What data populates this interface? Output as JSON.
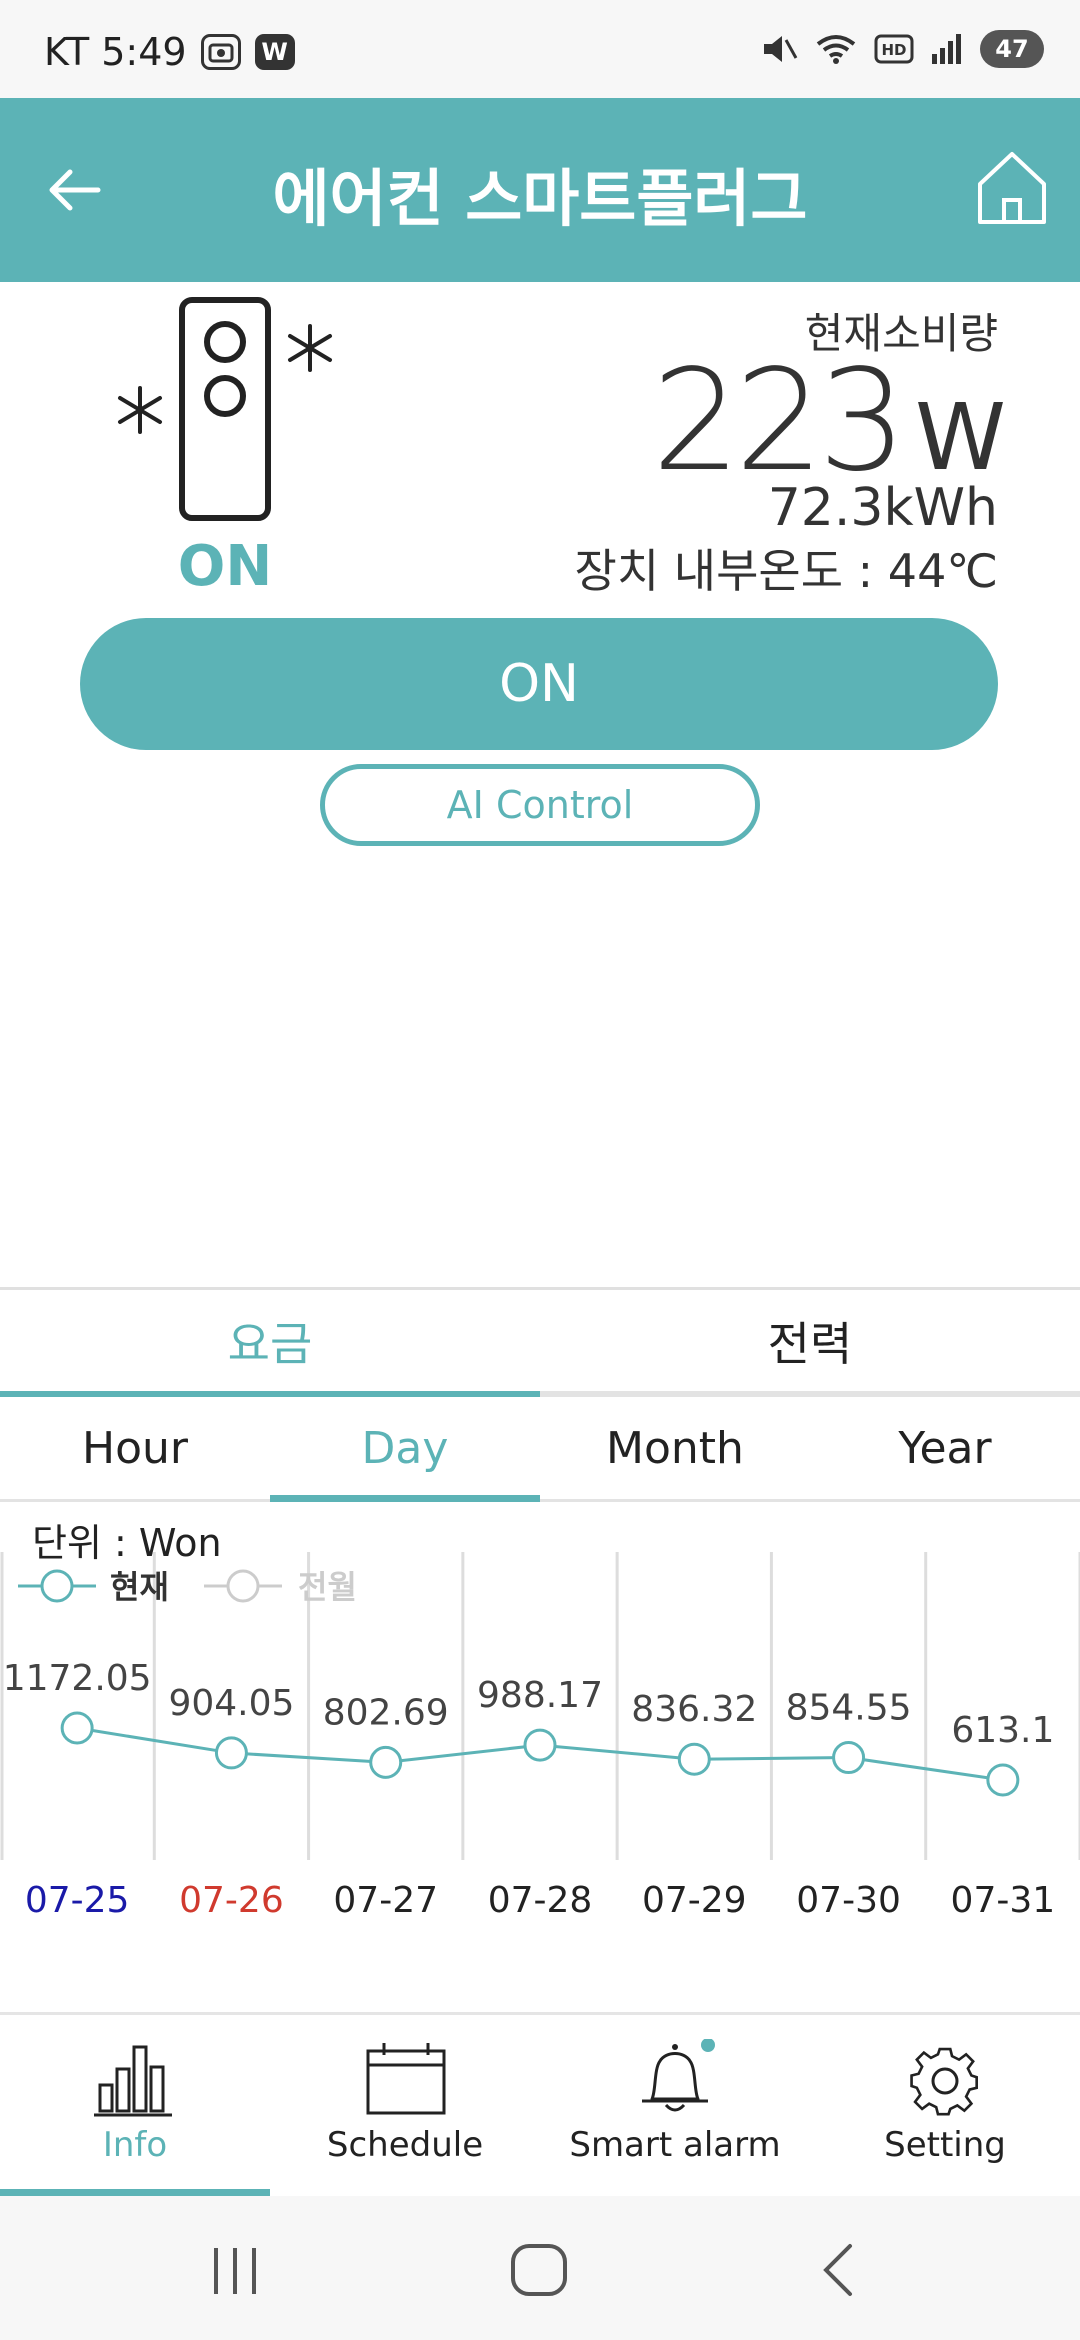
{
  "status_bar": {
    "carrier_time": "KT 5:49",
    "badge_1": "",
    "badge_2": "W",
    "battery": "47"
  },
  "header": {
    "title": "에어컨 스마트플러그"
  },
  "device": {
    "state": "ON",
    "current_label": "현재소비량",
    "current_value": "223",
    "current_unit": "W",
    "energy": "72.3kWh",
    "temperature": "장치 내부온도 : 44℃"
  },
  "controls": {
    "power_button": "ON",
    "ai_button": "AI Control"
  },
  "tabs": {
    "main": [
      {
        "label": "요금",
        "active": true
      },
      {
        "label": "전력",
        "active": false
      }
    ],
    "period": [
      {
        "label": "Hour",
        "active": false
      },
      {
        "label": "Day",
        "active": true
      },
      {
        "label": "Month",
        "active": false
      },
      {
        "label": "Year",
        "active": false
      }
    ]
  },
  "chart_data": {
    "type": "line",
    "unit_label": "단위 : Won",
    "categories": [
      "07-25",
      "07-26",
      "07-27",
      "07-28",
      "07-29",
      "07-30",
      "07-31"
    ],
    "category_colors": [
      "#1a1aa8",
      "#d03a2e",
      "#222222",
      "#222222",
      "#222222",
      "#222222",
      "#222222"
    ],
    "series": [
      {
        "name": "현재",
        "color": "#5cb3b6",
        "values": [
          1172.05,
          904.05,
          802.69,
          988.17,
          836.32,
          854.55,
          613.1
        ]
      },
      {
        "name": "전월",
        "color": "#cccccc",
        "values": []
      }
    ],
    "grid": "vertical"
  },
  "bottom_nav": [
    {
      "label": "Info",
      "icon": "bar-chart-icon",
      "active": true
    },
    {
      "label": "Schedule",
      "icon": "calendar-icon",
      "active": false
    },
    {
      "label": "Smart alarm",
      "icon": "bell-icon",
      "active": false
    },
    {
      "label": "Setting",
      "icon": "gear-icon",
      "active": false
    }
  ],
  "colors": {
    "accent": "#5cb3b6"
  }
}
